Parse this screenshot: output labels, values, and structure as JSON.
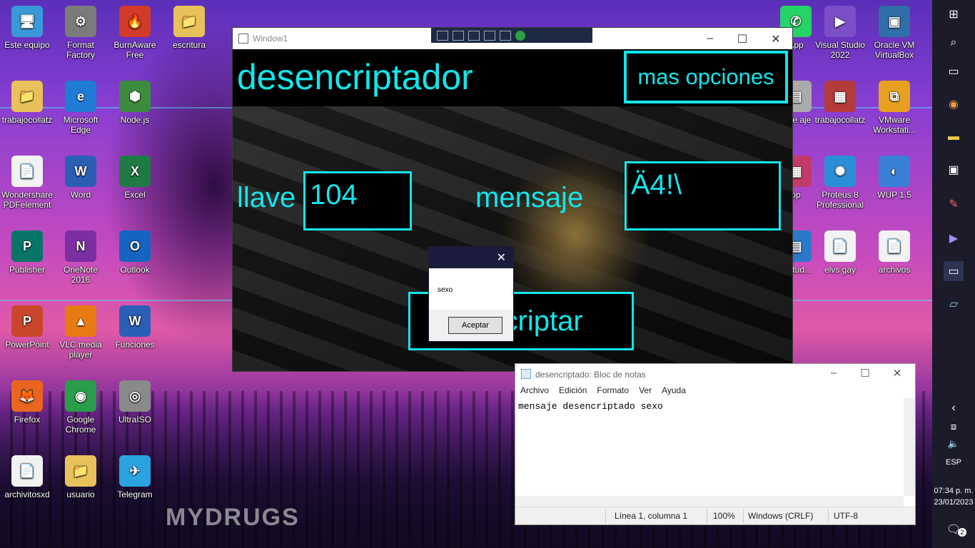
{
  "desktop": {
    "icons": [
      {
        "label": "Este equipo",
        "glyph": "🖥",
        "color": "#3a9ad9"
      },
      {
        "label": "Format Factory",
        "glyph": "⚙",
        "color": "#7b7b7b"
      },
      {
        "label": "BurnAware Free",
        "glyph": "🔥",
        "color": "#d23a2a"
      },
      {
        "label": "escritura",
        "glyph": "📁",
        "color": "#e8c15a"
      },
      {
        "label": "trabajocollatz",
        "glyph": "📁",
        "color": "#e8c15a"
      },
      {
        "label": "Microsoft Edge",
        "glyph": "e",
        "color": "#1f7bd4"
      },
      {
        "label": "Node.js",
        "glyph": "⬢",
        "color": "#3d8b3d"
      },
      {
        "label": "Wondershare PDFelement",
        "glyph": "📄",
        "color": "#f2f2f2"
      },
      {
        "label": "Word",
        "glyph": "W",
        "color": "#2b5fb5"
      },
      {
        "label": "Excel",
        "glyph": "X",
        "color": "#1f7a44"
      },
      {
        "label": "Publisher",
        "glyph": "P",
        "color": "#077568"
      },
      {
        "label": "OneNote 2016",
        "glyph": "N",
        "color": "#7b2fa3"
      },
      {
        "label": "Outlook",
        "glyph": "O",
        "color": "#1565c0"
      },
      {
        "label": "PowerPoint",
        "glyph": "P",
        "color": "#c8472b"
      },
      {
        "label": "VLC media player",
        "glyph": "▲",
        "color": "#e87a12"
      },
      {
        "label": "Funciones",
        "glyph": "W",
        "color": "#2b5fb5"
      },
      {
        "label": "Firefox",
        "glyph": "🦊",
        "color": "#e8661f"
      },
      {
        "label": "Google Chrome",
        "glyph": "◉",
        "color": "#2a9d4a"
      },
      {
        "label": "UltraISO",
        "glyph": "◎",
        "color": "#8a8a8a"
      },
      {
        "label": "archivitosxd",
        "glyph": "📄",
        "color": "#f2f2f2"
      },
      {
        "label": "usuario",
        "glyph": "📁",
        "color": "#e8c15a"
      },
      {
        "label": "Telegram",
        "glyph": "✈",
        "color": "#2ba3e0"
      },
      {
        "label": "App",
        "glyph": "✆",
        "color": "#25d366"
      },
      {
        "label": "Visual Studio 2022",
        "glyph": "▶",
        "color": "#7b4fc8"
      },
      {
        "label": "Oracle VM VirtualBox",
        "glyph": "▣",
        "color": "#2f6ea8"
      },
      {
        "label": "trabajocollatz",
        "glyph": "▦",
        "color": "#b53a3a"
      },
      {
        "label": "VMware Workstati...",
        "glyph": "⧉",
        "color": "#e8a020"
      },
      {
        "label": "Proteus 8 Professional",
        "glyph": "✺",
        "color": "#2b8fd8"
      },
      {
        "label": "WUP 1.5",
        "glyph": "◐",
        "color": "#3a7fd8"
      },
      {
        "label": "elvs gay",
        "glyph": "📄",
        "color": "#f2f2f2"
      },
      {
        "label": "archivos",
        "glyph": "📄",
        "color": "#f2f2f2"
      },
      {
        "label": "a de aje",
        "glyph": "▤",
        "color": "#aaaaaa"
      },
      {
        "label": "op",
        "glyph": "▦",
        "color": "#c23a6a"
      },
      {
        "label": "for tud...",
        "glyph": "▤",
        "color": "#2a7ac8"
      }
    ],
    "watermark": "MYDRUGS"
  },
  "taskbar": {
    "language": "ESP",
    "time": "07:34 p. m.",
    "date": "23/01/2023",
    "notifications": "2"
  },
  "window1": {
    "title": "Window1",
    "heading": "desencriptador",
    "more_options": "mas opciones",
    "key_label": "llave",
    "key_value": "104",
    "message_label": "mensaje",
    "message_value": "Ä4!\\",
    "decrypt_button": "ncriptar"
  },
  "messagebox": {
    "text": "sexo",
    "ok": "Aceptar"
  },
  "notepad": {
    "title": "desencriptado: Bloc de notas",
    "menu": [
      "Archivo",
      "Edición",
      "Formato",
      "Ver",
      "Ayuda"
    ],
    "content": "mensaje desencriptado sexo",
    "status_position": "Línea 1, columna 1",
    "zoom": "100%",
    "line_endings": "Windows (CRLF)",
    "encoding": "UTF-8"
  },
  "colors": {
    "accent": "#12e6ea",
    "titlebar_dark": "#1b1b3b"
  }
}
